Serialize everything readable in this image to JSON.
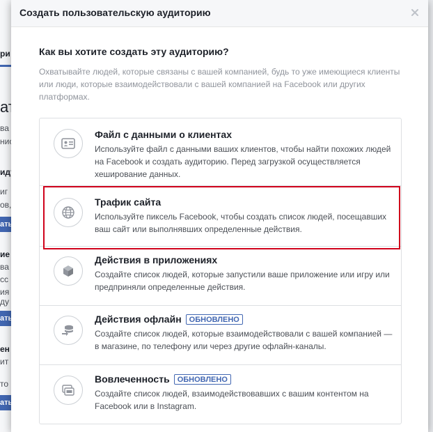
{
  "background": {
    "fragments": [
      "ри",
      "ат",
      "ва",
      "нис",
      "иду",
      "иг",
      "ов,",
      "ие",
      "ва",
      "сс",
      "ия",
      "ду",
      "ен",
      "ит",
      "то",
      "ва"
    ],
    "button_fragment": "ать"
  },
  "dialog": {
    "title": "Создать пользовательскую аудиторию",
    "close_symbol": "×",
    "question": "Как вы хотите создать эту аудиторию?",
    "description": "Охватывайте людей, которые связаны с вашей компанией, будь то уже имеющиеся клиенты или люди, которые взаимодействовали с вашей компанией на Facebook или других платформах."
  },
  "options": [
    {
      "icon": "customer-file-icon",
      "title": "Файл с данными о клиентах",
      "description": "Используйте файл с данными ваших клиентов, чтобы найти похожих людей на Facebook и создать аудиторию. Перед загрузкой осуществляется хеширование данных."
    },
    {
      "icon": "globe-icon",
      "title": "Трафик сайта",
      "description": "Используйте пиксель Facebook, чтобы создать список людей, посещавших ваш сайт или выполнявших определенные действия."
    },
    {
      "icon": "app-cube-icon",
      "title": "Действия в приложениях",
      "description": "Создайте список людей, которые запустили ваше приложение или игру или предприняли определенные действия."
    },
    {
      "icon": "offline-store-icon",
      "title": "Действия офлайн",
      "badge": "ОБНОВЛЕНО",
      "description": "Создайте список людей, которые взаимодействовали с вашей компанией — в магазине, по телефону или через другие офлайн-каналы."
    },
    {
      "icon": "engagement-icon",
      "title": "Вовлеченность",
      "badge": "ОБНОВЛЕНО",
      "description": "Создайте список людей, взаимодействовавших с вашим контентом на Facebook или в Instagram."
    }
  ],
  "colors": {
    "highlight": "#d0021b",
    "badge": "#4267b2",
    "accent": "#4267b2"
  }
}
